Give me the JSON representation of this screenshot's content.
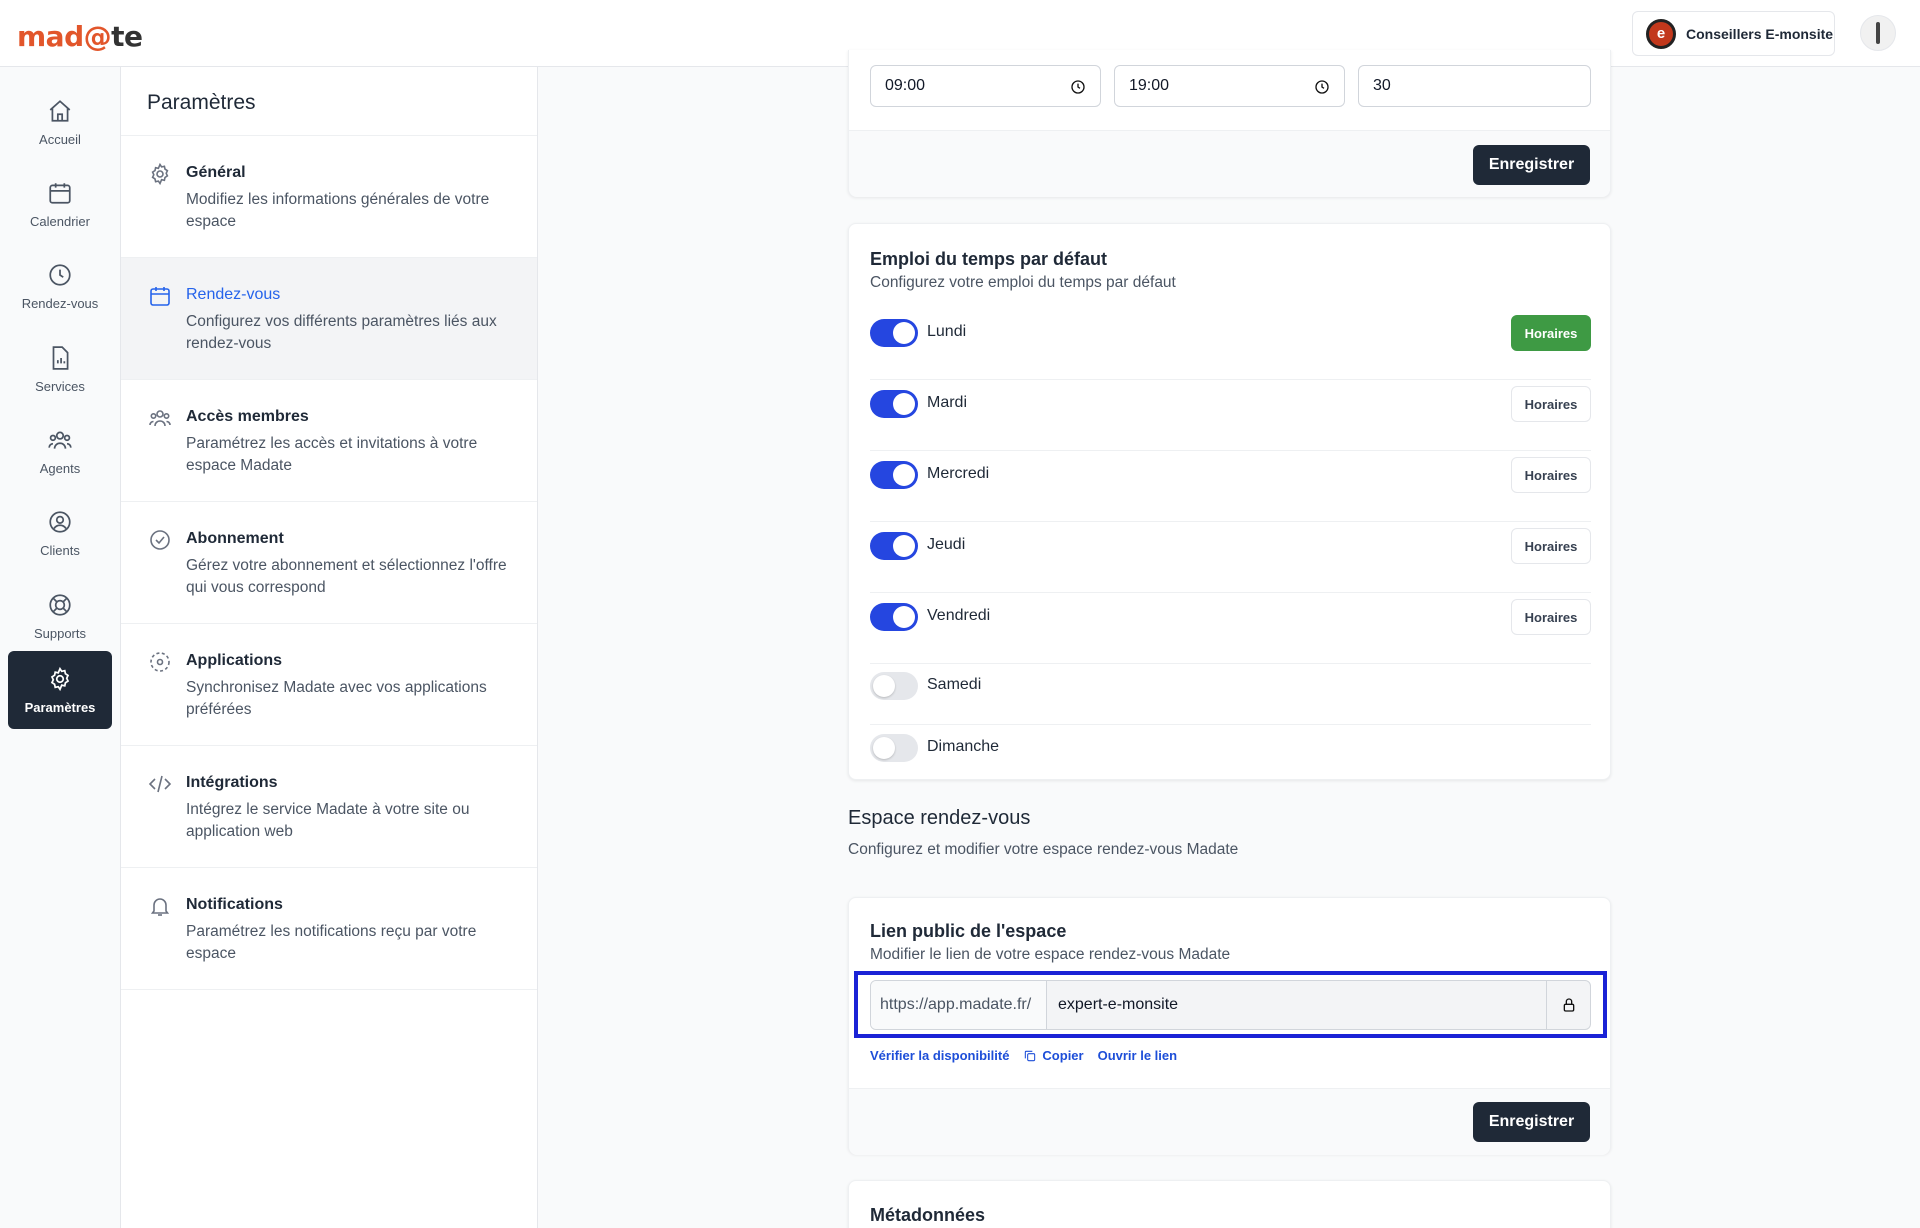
{
  "brand": {
    "logo_prefix": "mad",
    "logo_mid": "@",
    "logo_suffix": "te"
  },
  "header": {
    "account_initial": "e",
    "account_name": "Conseillers E-monsite"
  },
  "sidenav": {
    "items": [
      {
        "label": "Accueil",
        "icon": "home-icon"
      },
      {
        "label": "Calendrier",
        "icon": "calendar-icon"
      },
      {
        "label": "Rendez-vous",
        "icon": "clock-icon"
      },
      {
        "label": "Services",
        "icon": "document-chart-icon"
      },
      {
        "label": "Agents",
        "icon": "users-icon"
      },
      {
        "label": "Clients",
        "icon": "user-circle-icon"
      },
      {
        "label": "Supports",
        "icon": "lifebuoy-icon"
      },
      {
        "label": "Paramètres",
        "icon": "gear-icon",
        "active": true
      }
    ]
  },
  "settings": {
    "title": "Paramètres",
    "items": [
      {
        "title": "Général",
        "desc": "Modifiez les informations générales de votre espace",
        "icon": "gear-icon"
      },
      {
        "title": "Rendez-vous",
        "desc": "Configurez vos différents paramètres liés aux rendez-vous",
        "icon": "calendar-icon",
        "active": true
      },
      {
        "title": "Accès membres",
        "desc": "Paramétrez les accès et invitations à votre espace Madate",
        "icon": "users-icon"
      },
      {
        "title": "Abonnement",
        "desc": "Gérez votre abonnement et sélectionnez l'offre qui vous correspond",
        "icon": "check-circle-icon"
      },
      {
        "title": "Applications",
        "desc": "Synchronisez Madate avec vos applications préférées",
        "icon": "sync-icon"
      },
      {
        "title": "Intégrations",
        "desc": "Intégrez le service Madate à votre site ou application web",
        "icon": "code-icon"
      },
      {
        "title": "Notifications",
        "desc": "Paramétrez les notifications reçu par votre espace",
        "icon": "bell-icon"
      }
    ]
  },
  "hours_card": {
    "start": "09:00",
    "end": "19:00",
    "interval": "30",
    "save_label": "Enregistrer"
  },
  "schedule": {
    "title": "Emploi du temps par défaut",
    "subtitle": "Configurez votre emploi du temps par défaut",
    "horaires_label": "Horaires",
    "days": [
      {
        "label": "Lundi",
        "enabled": true
      },
      {
        "label": "Mardi",
        "enabled": true
      },
      {
        "label": "Mercredi",
        "enabled": true
      },
      {
        "label": "Jeudi",
        "enabled": true
      },
      {
        "label": "Vendredi",
        "enabled": true
      },
      {
        "label": "Samedi",
        "enabled": false
      },
      {
        "label": "Dimanche",
        "enabled": false
      }
    ]
  },
  "espace": {
    "title": "Espace rendez-vous",
    "subtitle": "Configurez et modifier votre espace rendez-vous Madate"
  },
  "public_link": {
    "title": "Lien public de l'espace",
    "subtitle": "Modifier le lien de votre espace rendez-vous Madate",
    "prefix": "https://app.madate.fr/",
    "slug": "expert-e-monsite",
    "verify_label": "Vérifier la disponibilité",
    "copy_label": "Copier",
    "open_label": "Ouvrir le lien",
    "save_label": "Enregistrer"
  },
  "metadata": {
    "title": "Métadonnées"
  },
  "colors": {
    "accent": "#2546e0",
    "success": "#3e9a44",
    "dark": "#1f2937",
    "highlight": "#1a22d6"
  }
}
